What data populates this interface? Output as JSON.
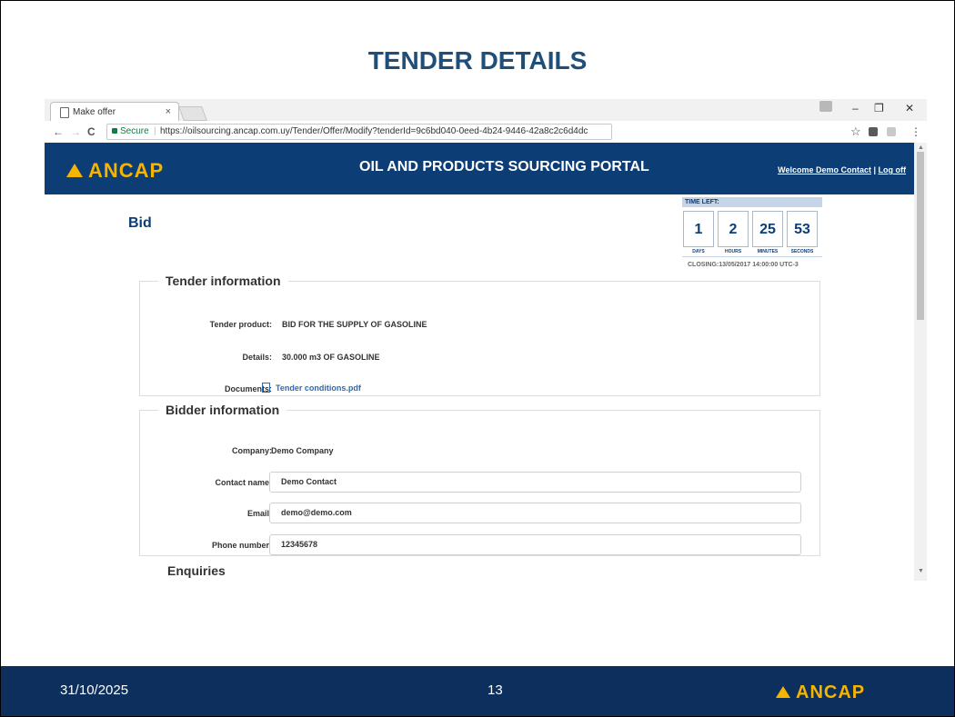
{
  "slide": {
    "title": "TENDER DETAILS",
    "footer": {
      "date": "31/10/2025",
      "page": "13",
      "logo": "ANCAP"
    }
  },
  "browser": {
    "tab_title": "Make offer",
    "tab_close": "×",
    "secure_label": "Secure",
    "url": "https://oilsourcing.ancap.com.uy/Tender/Offer/Modify?tenderId=9c6bd040-0eed-4b24-9446-42a8c2c6d4dc",
    "nav": {
      "back": "←",
      "forward": "→",
      "reload": "C"
    },
    "window": {
      "minimize": "–",
      "restore": "❐",
      "close": "✕"
    },
    "star": "☆",
    "menu": "⋮"
  },
  "site": {
    "logo": "ANCAP",
    "portal_title": "OIL AND PRODUCTS SOURCING PORTAL",
    "welcome": "Welcome Demo Contact",
    "separator": " | ",
    "logoff": "Log off",
    "page_title": "Bid"
  },
  "timer": {
    "header": "TIME LEFT:",
    "units": [
      {
        "value": "1",
        "label": "DAYS"
      },
      {
        "value": "2",
        "label": "HOURS"
      },
      {
        "value": "25",
        "label": "MINUTES"
      },
      {
        "value": "53",
        "label": "SECONDS"
      }
    ],
    "closing": "CLOSING:13/05/2017 14:00:00 UTC-3"
  },
  "tender": {
    "legend": "Tender information",
    "product_label": "Tender product:",
    "product_value": "BID FOR THE SUPPLY OF GASOLINE",
    "details_label": "Details:",
    "details_value": "30.000 m3 OF GASOLINE",
    "documents_label": "Documents:",
    "document_link": "Tender conditions.pdf"
  },
  "bidder": {
    "legend": "Bidder information",
    "company_label": "Company:",
    "company_value": "Demo Company",
    "contact_label": "Contact name:",
    "contact_value": "Demo Contact",
    "email_label": "Email:",
    "email_value": "demo@demo.com",
    "phone_label": "Phone number:",
    "phone_value": "12345678"
  },
  "enquiries": {
    "legend": "Enquiries"
  },
  "icons": {
    "tab": "document-icon",
    "lock": "lock-icon",
    "pdf": "pdf-file-icon",
    "star": "star-icon",
    "logo": "ancap-triangle-icon"
  },
  "colors": {
    "header_bg": "#0d3d75",
    "footer_bg": "#0d2f5d",
    "accent_yellow": "#f5b400",
    "title_blue": "#1f4e79",
    "link_blue": "#2a6ab3",
    "secure_green": "#0b8043"
  }
}
